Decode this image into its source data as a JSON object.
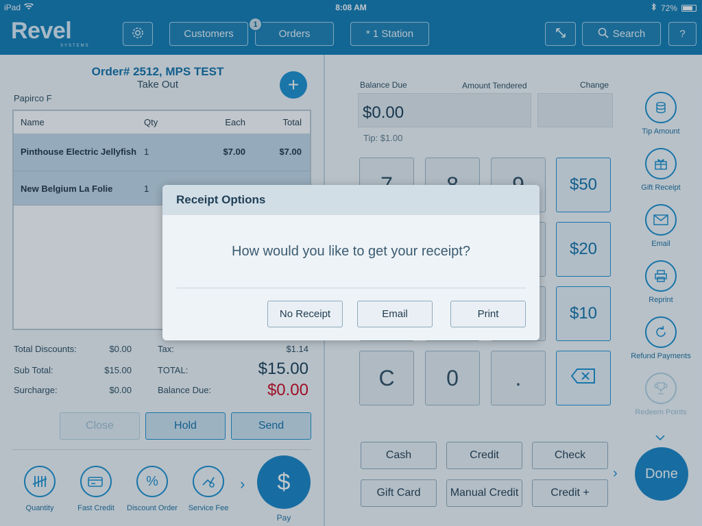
{
  "status_bar": {
    "device": "iPad",
    "time": "8:08 AM",
    "battery": "72%"
  },
  "header": {
    "logo": "Revel",
    "logo_sub": "SYSTEMS",
    "customers_label": "Customers",
    "orders_label": "Orders",
    "orders_badge": "1",
    "station_label": "* 1 Station",
    "search_label": "Search",
    "help_label": "?"
  },
  "order": {
    "title": "Order# 2512, MPS TEST",
    "type": "Take Out",
    "customer": "Papirco F",
    "columns": {
      "name": "Name",
      "qty": "Qty",
      "each": "Each",
      "total": "Total"
    },
    "items": [
      {
        "name": "Pinthouse Electric Jellyfish",
        "qty": "1",
        "each": "$7.00",
        "total": "$7.00"
      },
      {
        "name": "New Belgium La Folie",
        "qty": "1",
        "each": "",
        "total": ""
      }
    ],
    "totals": {
      "discounts_label": "Total Discounts:",
      "discounts": "$0.00",
      "tax_label": "Tax:",
      "tax": "$1.14",
      "subtotal_label": "Sub Total:",
      "subtotal": "$15.00",
      "total_label": "TOTAL:",
      "total": "$15.00",
      "surcharge_label": "Surcharge:",
      "surcharge": "$0.00",
      "due_label": "Balance Due:",
      "due": "$0.00"
    },
    "actions": {
      "close": "Close",
      "hold": "Hold",
      "send": "Send"
    },
    "quick": [
      {
        "label": "Quantity"
      },
      {
        "label": "Fast Credit"
      },
      {
        "label": "Discount Order"
      },
      {
        "label": "Service Fee"
      }
    ],
    "pay_label": "Pay"
  },
  "payment": {
    "balance_due_label": "Balance Due",
    "amount_tendered_label": "Amount Tendered",
    "change_label": "Change",
    "balance_due": "$0.00",
    "tip": "Tip: $1.00",
    "keys_row1": [
      "7",
      "8",
      "9"
    ],
    "keys_row4": [
      "C",
      "0",
      "."
    ],
    "money": [
      "$50",
      "$20",
      "$10"
    ],
    "tenders": [
      "Cash",
      "Credit",
      "Check",
      "Gift Card",
      "Manual Credit",
      "Credit +"
    ],
    "side_actions": [
      "Tip Amount",
      "Gift Receipt",
      "Email",
      "Reprint",
      "Refund Payments",
      "Redeem Points"
    ],
    "done_label": "Done"
  },
  "modal": {
    "title": "Receipt Options",
    "question": "How would you like to get your receipt?",
    "no_receipt": "No Receipt",
    "email": "Email",
    "print": "Print"
  }
}
